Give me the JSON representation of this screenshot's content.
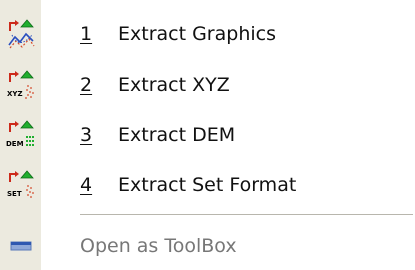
{
  "menu": {
    "items": [
      {
        "number": "1",
        "label": "Extract Graphics",
        "icon": "extract-graphics-icon"
      },
      {
        "number": "2",
        "label": "Extract XYZ",
        "icon": "extract-xyz-icon",
        "icon_text": "XYZ"
      },
      {
        "number": "3",
        "label": "Extract DEM",
        "icon": "extract-dem-icon",
        "icon_text": "DEM"
      },
      {
        "number": "4",
        "label": "Extract Set Format",
        "icon": "extract-set-icon",
        "icon_text": "SET"
      }
    ],
    "toolbox": {
      "label": "Open as ToolBox",
      "icon": "toolbox-icon"
    },
    "colors": {
      "gutter": "#eceadf",
      "arrow": "#cc2a1a",
      "triangle": "#1fae2e",
      "dots": "#d4492a",
      "disabled_text": "#777777"
    }
  }
}
